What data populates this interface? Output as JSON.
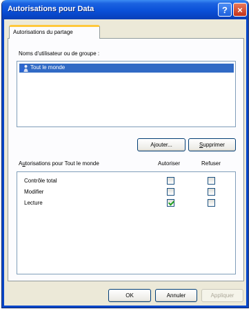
{
  "window": {
    "title": "Autorisations pour Data",
    "help_label": "?",
    "close_label": "×"
  },
  "tabs": [
    {
      "label": "Autorisations du partage",
      "selected": true
    }
  ],
  "users": {
    "group_label": "Noms d'utilisateur ou de groupe :",
    "items": [
      {
        "label": "Tout le monde",
        "icon": "users-group-icon",
        "selected": true
      }
    ]
  },
  "buttons": {
    "add_prefix": "A",
    "add_underline": "j",
    "add_suffix": "outer...",
    "remove_underline": "S",
    "remove_suffix": "upprimer",
    "ok": "OK",
    "cancel": "Annuler",
    "apply": "Appliquer"
  },
  "permissions": {
    "header_prefix": "A",
    "header_underline": "u",
    "header_suffix": "torisations pour Tout le monde",
    "allow_header": "Autoriser",
    "deny_header": "Refuser",
    "rows": [
      {
        "name": "Contrôle total",
        "allow": false,
        "deny": false
      },
      {
        "name": "Modifier",
        "allow": false,
        "deny": false
      },
      {
        "name": "Lecture",
        "allow": true,
        "deny": false
      }
    ]
  }
}
